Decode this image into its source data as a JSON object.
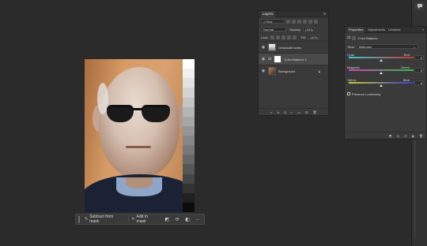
{
  "right_toolbar": {
    "icons": [
      "comment-icon"
    ]
  },
  "task_bar": {
    "subtract_label": "Subtract from mask",
    "add_label": "Add to mask",
    "more_label": "..."
  },
  "layers_panel": {
    "tab": "Layers",
    "filter_kind": "Kind",
    "blend_mode": "Normal",
    "opacity_label": "Opacity:",
    "opacity_value": "100%",
    "lock_label": "Lock:",
    "fill_label": "Fill:",
    "fill_value": "100%",
    "layers": [
      {
        "name": "Greyscale tones"
      },
      {
        "name": "Color Balance 1"
      },
      {
        "name": "Background"
      }
    ]
  },
  "properties_panel": {
    "tabs": [
      "Properties",
      "Adjustments",
      "Libraries"
    ],
    "title": "Color Balance",
    "tone_label": "Tone:",
    "tone_value": "Midtones",
    "sliders": [
      {
        "left": "Cyan",
        "right": "Red",
        "value": "0",
        "colors": [
          "#2fd0d0",
          "#d03030"
        ]
      },
      {
        "left": "Magenta",
        "right": "Green",
        "value": "0",
        "colors": [
          "#d040c0",
          "#30c040"
        ]
      },
      {
        "left": "Yellow",
        "right": "Blue",
        "value": "0",
        "colors": [
          "#d0c830",
          "#3040d0"
        ]
      }
    ],
    "preserve_label": "Preserve Luminosity"
  },
  "colors": {
    "app_bg": "#2b2b2b",
    "panel_bg": "#3a3a3a"
  }
}
